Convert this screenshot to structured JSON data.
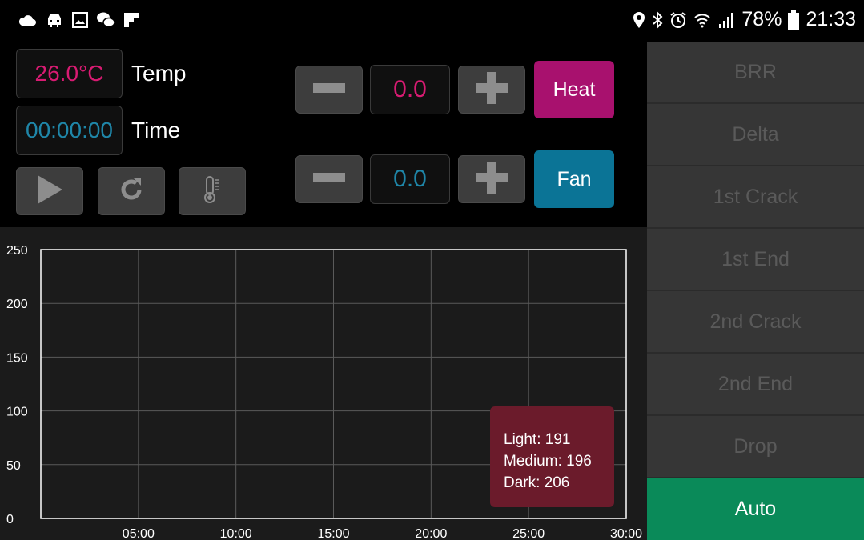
{
  "status_bar": {
    "left_icons": [
      "cloud-icon",
      "car-icon",
      "gallery-icon",
      "wechat-icon",
      "flipboard-icon"
    ],
    "right_icons": [
      "location-icon",
      "bluetooth-icon",
      "alarm-icon",
      "wifi-icon",
      "signal-icon",
      "battery-icon"
    ],
    "battery_percent": "78%",
    "time": "21:33"
  },
  "readouts": {
    "temp_value": "26.0°C",
    "temp_label": "Temp",
    "time_value": "00:00:00",
    "time_label": "Time"
  },
  "controls": {
    "heat": {
      "value": "0.0",
      "label": "Heat",
      "color": "#a8116e"
    },
    "fan": {
      "value": "0.0",
      "label": "Fan",
      "color": "#0b7496"
    },
    "playback_icons": [
      "play-icon",
      "reset-icon",
      "thermometer-icon"
    ]
  },
  "side_buttons": [
    {
      "label": "BRR"
    },
    {
      "label": "Delta"
    },
    {
      "label": "1st Crack"
    },
    {
      "label": "1st End"
    },
    {
      "label": "2nd Crack"
    },
    {
      "label": "2nd End"
    },
    {
      "label": "Drop"
    },
    {
      "label": "Auto"
    }
  ],
  "colors": {
    "temp_accent": "#d81b72",
    "time_accent": "#1f86a8",
    "auto_active": "#0a8a59"
  },
  "chart_data": {
    "type": "line",
    "x_ticks": [
      "05:00",
      "10:00",
      "15:00",
      "20:00",
      "25:00",
      "30:00"
    ],
    "y_ticks": [
      "0",
      "50",
      "100",
      "150",
      "200",
      "250"
    ],
    "xlim": [
      0,
      30
    ],
    "ylim": [
      0,
      250
    ],
    "grid": true,
    "series": [],
    "tooltip": [
      "Light: 191",
      "Medium: 196",
      "Dark: 206"
    ]
  }
}
